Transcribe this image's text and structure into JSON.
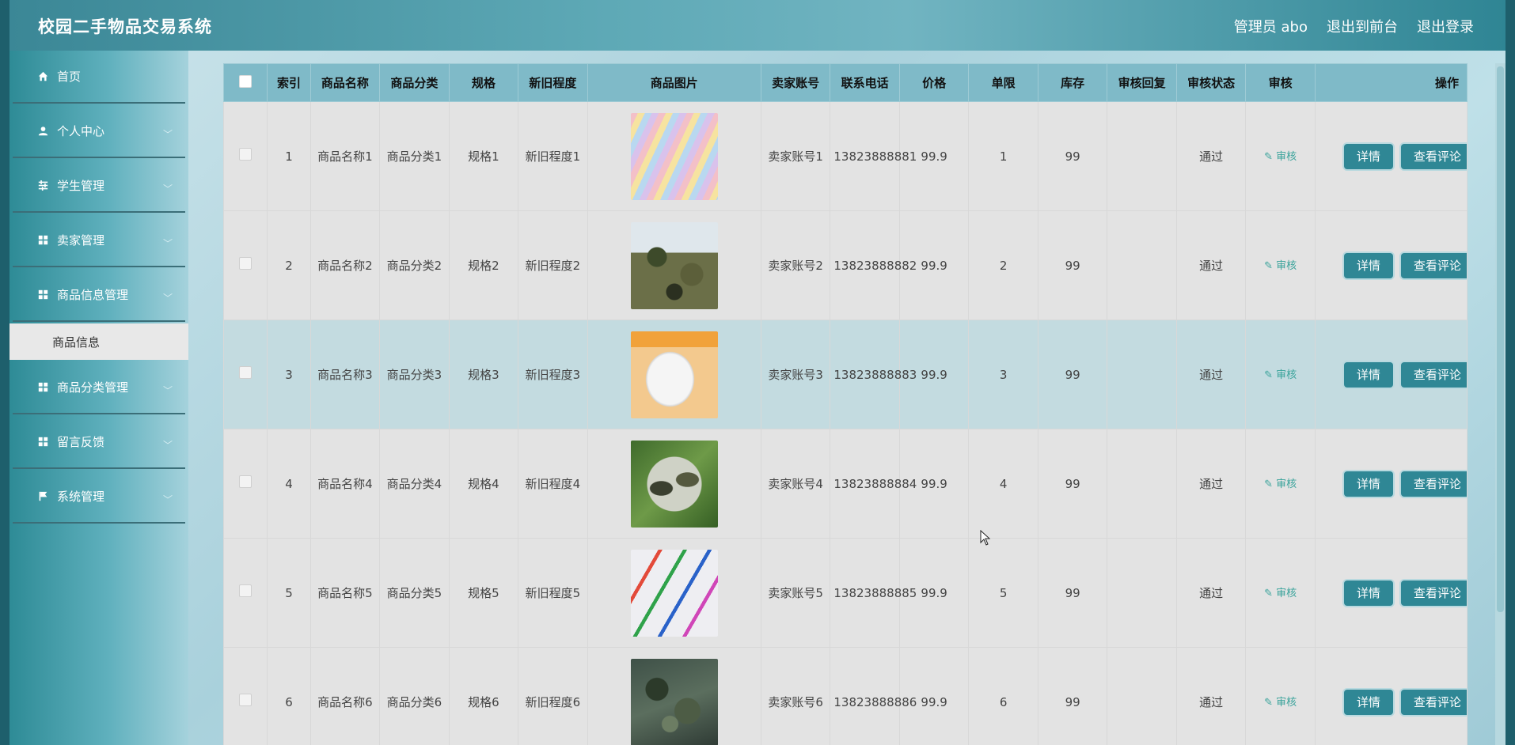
{
  "header": {
    "title": "校园二手物品交易系统",
    "admin_label": "管理员 abo",
    "front_link": "退出到前台",
    "logout_link": "退出登录"
  },
  "sidebar": {
    "items": [
      {
        "label": "首页",
        "icon": "home-icon"
      },
      {
        "label": "个人中心",
        "icon": "user-icon"
      },
      {
        "label": "学生管理",
        "icon": "sliders-icon"
      },
      {
        "label": "卖家管理",
        "icon": "grid-icon"
      },
      {
        "label": "商品信息管理",
        "icon": "grid-icon"
      },
      {
        "label": "商品分类管理",
        "icon": "grid-icon"
      },
      {
        "label": "留言反馈",
        "icon": "grid-icon"
      },
      {
        "label": "系统管理",
        "icon": "flag-icon"
      }
    ],
    "submenu": {
      "label": "商品信息"
    }
  },
  "table": {
    "columns": [
      "索引",
      "商品名称",
      "商品分类",
      "规格",
      "新旧程度",
      "商品图片",
      "卖家账号",
      "联系电话",
      "价格",
      "单限",
      "库存",
      "审核回复",
      "审核状态",
      "审核",
      "操作"
    ],
    "audit_label": "审核",
    "detail_button": "详情",
    "review_button": "查看评论",
    "rows": [
      {
        "index": "1",
        "name": "商品名称1",
        "category": "商品分类1",
        "spec": "规格1",
        "condition": "新旧程度1",
        "image": "bedding",
        "seller": "卖家账号1",
        "phone": "13823888881",
        "price": "99.9",
        "limit": "1",
        "stock": "99",
        "reply": "",
        "status": "通过"
      },
      {
        "index": "2",
        "name": "商品名称2",
        "category": "商品分类2",
        "spec": "规格2",
        "condition": "新旧程度2",
        "image": "camouflage-uniform",
        "seller": "卖家账号2",
        "phone": "13823888882",
        "price": "99.9",
        "limit": "2",
        "stock": "99",
        "reply": "",
        "status": "通过"
      },
      {
        "index": "3",
        "name": "商品名称3",
        "category": "商品分类3",
        "spec": "规格3",
        "condition": "新旧程度3",
        "image": "mug",
        "seller": "卖家账号3",
        "phone": "13823888883",
        "price": "99.9",
        "limit": "3",
        "stock": "99",
        "reply": "",
        "status": "通过"
      },
      {
        "index": "4",
        "name": "商品名称4",
        "category": "商品分类4",
        "spec": "规格4",
        "condition": "新旧程度4",
        "image": "camo-shoes",
        "seller": "卖家账号4",
        "phone": "13823888884",
        "price": "99.9",
        "limit": "4",
        "stock": "99",
        "reply": "",
        "status": "通过"
      },
      {
        "index": "5",
        "name": "商品名称5",
        "category": "商品分类5",
        "spec": "规格5",
        "condition": "新旧程度5",
        "image": "toothbrushes",
        "seller": "卖家账号5",
        "phone": "13823888885",
        "price": "99.9",
        "limit": "5",
        "stock": "99",
        "reply": "",
        "status": "通过"
      },
      {
        "index": "6",
        "name": "商品名称6",
        "category": "商品分类6",
        "spec": "规格6",
        "condition": "新旧程度6",
        "image": "camo-boots",
        "seller": "卖家账号6",
        "phone": "13823888886",
        "price": "99.9",
        "limit": "6",
        "stock": "99",
        "reply": "",
        "status": "通过"
      }
    ]
  }
}
